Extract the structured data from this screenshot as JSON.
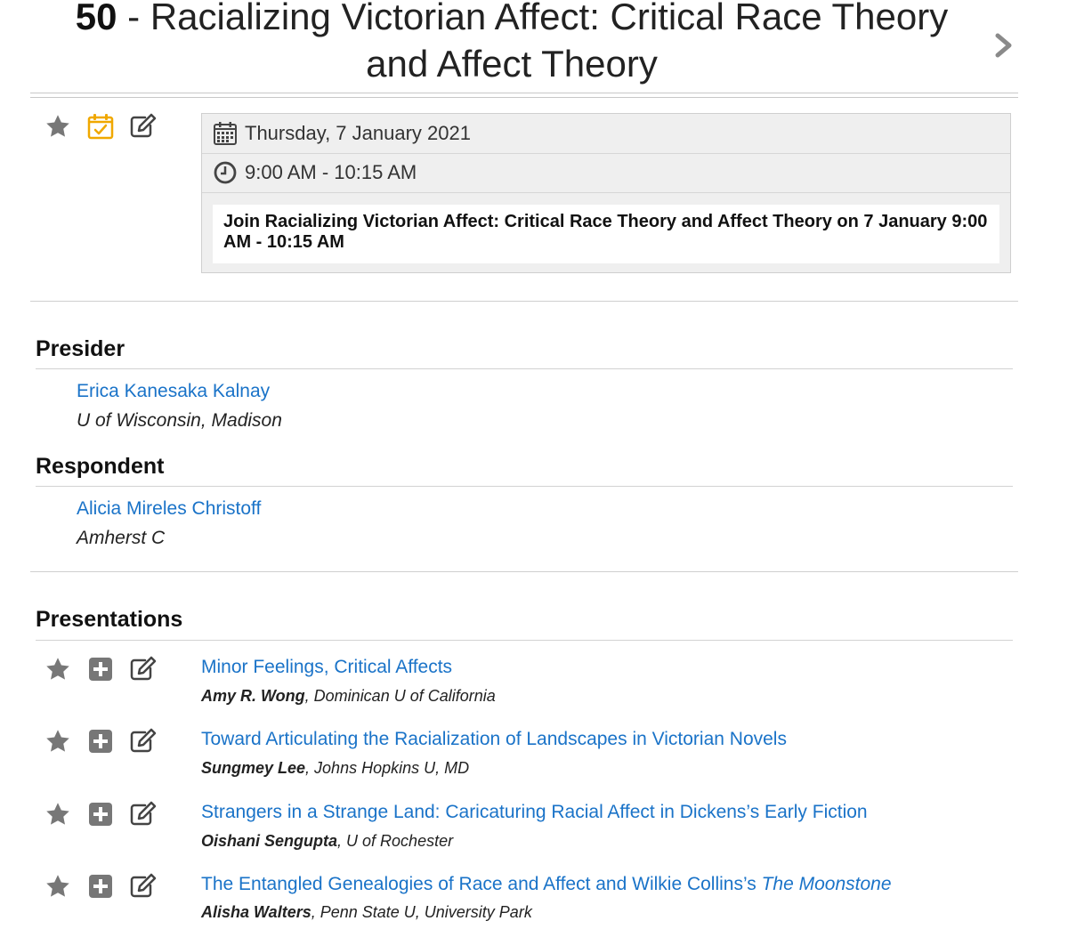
{
  "session": {
    "number": "50",
    "separator": " - ",
    "title": "Racializing Victorian Affect: Critical Race Theory and Affect Theory"
  },
  "schedule": {
    "date": "Thursday, 7 January 2021",
    "time": "9:00 AM - 10:15 AM",
    "join_text": "Join Racializing Victorian Affect: Critical Race Theory and Affect Theory on 7 January 9:00 AM - 10:15 AM"
  },
  "presider": {
    "heading": "Presider",
    "name": "Erica Kanesaka Kalnay",
    "affiliation": "U of Wisconsin, Madison"
  },
  "respondent": {
    "heading": "Respondent",
    "name": "Alicia Mireles Christoff",
    "affiliation": "Amherst C"
  },
  "presentations": {
    "heading": "Presentations",
    "items": [
      {
        "title": "Minor Feelings, Critical Affects",
        "title_italic": "",
        "author": "Amy R. Wong",
        "affiliation": ", Dominican U of California"
      },
      {
        "title": "Toward Articulating the Racialization of Landscapes in Victorian Novels",
        "title_italic": "",
        "author": "Sungmey Lee",
        "affiliation": ", Johns Hopkins U, MD"
      },
      {
        "title": "Strangers in a Strange Land: Caricaturing Racial Affect in Dickens’s Early Fiction",
        "title_italic": "",
        "author": "Oishani Sengupta",
        "affiliation": ", U of Rochester"
      },
      {
        "title": "The Entangled Genealogies of Race and Affect and Wilkie Collins’s ",
        "title_italic": "The Moonstone",
        "author": "Alisha Walters",
        "affiliation": ", Penn State U, University Park"
      }
    ]
  },
  "icons": {
    "star": "star-icon",
    "calendar_check": "calendar-check-icon",
    "edit": "edit-icon",
    "add": "plus-square-icon",
    "calendar": "calendar-icon",
    "clock": "clock-icon",
    "next": "chevron-right-icon"
  },
  "colors": {
    "link": "#1a73c8",
    "icon_gray": "#777777",
    "calendar_accent": "#f0a800"
  }
}
